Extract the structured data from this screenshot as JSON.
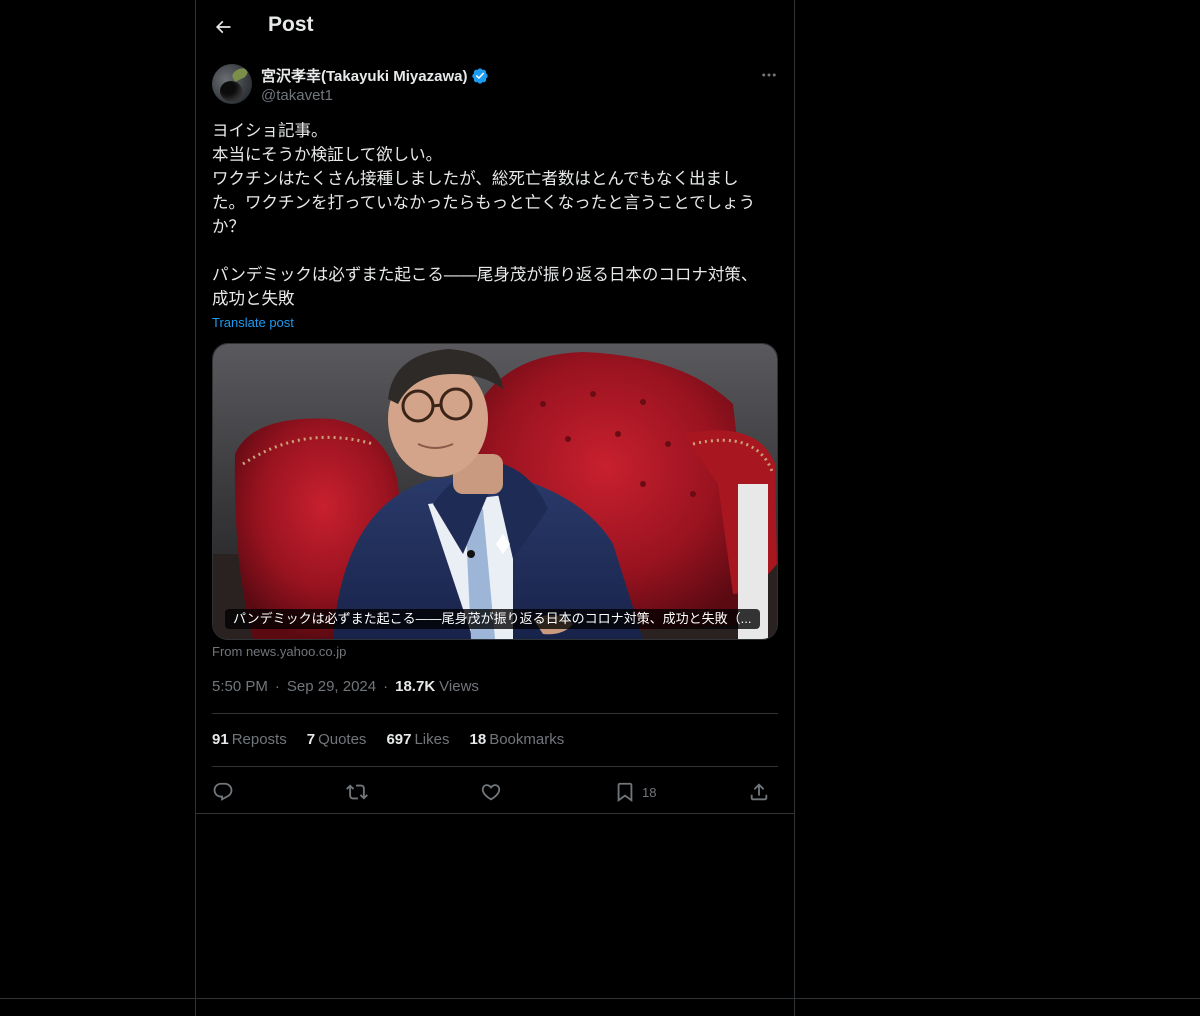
{
  "header": {
    "title": "Post",
    "back_icon": "arrow-left-icon"
  },
  "author": {
    "name": "宮沢孝幸(Takayuki Miyazawa)",
    "handle": "@takavet1",
    "verified": true,
    "verified_color": "#1d9bf0"
  },
  "post": {
    "text": "ヨイショ記事。\n本当にそうか検証して欲しい。\nワクチンはたくさん接種しましたが、総死亡者数はとんでもなく出まし\nた。ワクチンを打っていなかったらもっと亡くなったと言うことでしょう\nか？\n\nパンデミックは必ずまた起こる——尾身茂が振り返る日本のコロナ対策、\n成功と失敗",
    "translate_label": "Translate post"
  },
  "card": {
    "caption": "パンデミックは必ずまた起こる——尾身茂が振り返る日本のコロナ対策、成功と失敗（...",
    "source": "From news.yahoo.co.jp"
  },
  "meta": {
    "time": "5:50 PM",
    "date": "Sep 29, 2024",
    "views_count": "18.7K",
    "views_label": "Views"
  },
  "stats": {
    "reposts_count": "91",
    "reposts_label": "Reposts",
    "quotes_count": "7",
    "quotes_label": "Quotes",
    "likes_count": "697",
    "likes_label": "Likes",
    "bookmarks_count": "18",
    "bookmarks_label": "Bookmarks"
  },
  "actions": {
    "reply_icon": "reply-icon",
    "repost_icon": "repost-icon",
    "like_icon": "heart-icon",
    "bookmark_icon": "bookmark-icon",
    "bookmark_count": "18",
    "share_icon": "share-icon"
  },
  "colors": {
    "background": "#000000",
    "text": "#e7e9ea",
    "muted": "#71767b",
    "accent": "#1d9bf0",
    "border": "#2f3336"
  }
}
